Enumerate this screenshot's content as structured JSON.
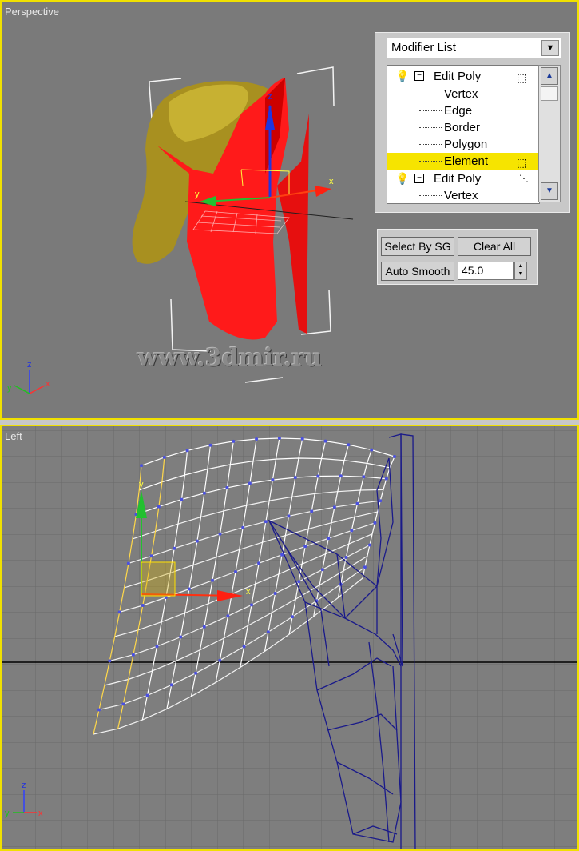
{
  "viewports": {
    "perspective": {
      "label": "Perspective"
    },
    "left": {
      "label": "Left"
    }
  },
  "watermark": "www.3dmir.ru",
  "axis_labels": {
    "x": "x",
    "y": "y",
    "z": "z"
  },
  "modifier_panel": {
    "dropdown_value": "Modifier List",
    "stack": [
      {
        "label": "Edit Poly",
        "kind": "modifier",
        "icon": "lightbulb-icon"
      },
      {
        "label": "Vertex",
        "kind": "sub"
      },
      {
        "label": "Edge",
        "kind": "sub"
      },
      {
        "label": "Border",
        "kind": "sub"
      },
      {
        "label": "Polygon",
        "kind": "sub"
      },
      {
        "label": "Element",
        "kind": "sub",
        "selected": true
      },
      {
        "label": "Edit Poly",
        "kind": "modifier",
        "icon": "lightbulb-icon"
      },
      {
        "label": "Vertex",
        "kind": "sub"
      }
    ]
  },
  "smoothing_panel": {
    "select_by_sg": "Select By SG",
    "clear_all": "Clear All",
    "auto_smooth": "Auto Smooth",
    "threshold": "45.0"
  },
  "colors": {
    "viewport_border_active": "#f0e000",
    "helmet_red": "#ff1a1a",
    "helmet_gold": "#a89020",
    "selection_yellow": "#f6e400",
    "wire_blue": "#1a1a8a"
  }
}
